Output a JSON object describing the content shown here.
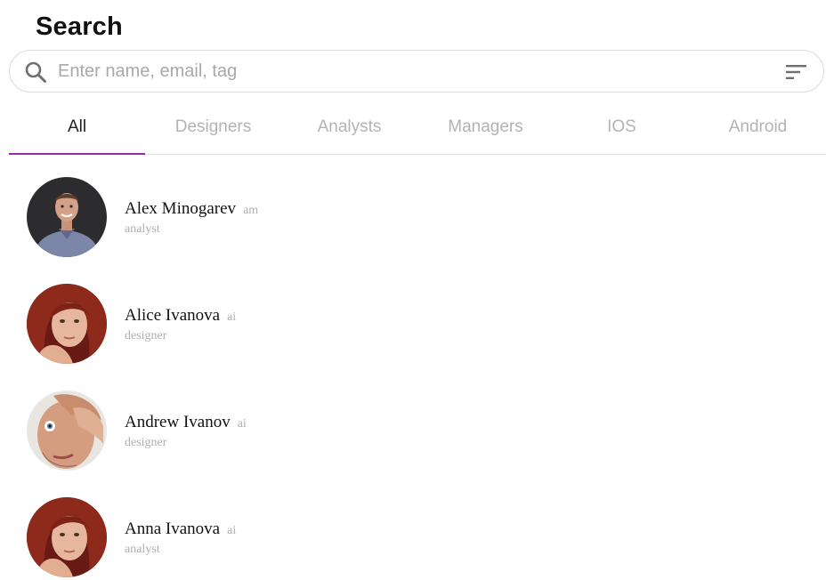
{
  "header": {
    "title": "Search"
  },
  "search": {
    "placeholder": "Enter name, email, tag",
    "value": "",
    "icon": "search-icon",
    "filter_icon": "filter-sort-icon"
  },
  "tabs": [
    {
      "label": "All",
      "active": true
    },
    {
      "label": "Designers",
      "active": false
    },
    {
      "label": "Analysts",
      "active": false
    },
    {
      "label": "Managers",
      "active": false
    },
    {
      "label": "IOS",
      "active": false
    },
    {
      "label": "Android",
      "active": false
    }
  ],
  "people": [
    {
      "name": "Alex Minogarev",
      "initials": "am",
      "role": "analyst"
    },
    {
      "name": "Alice Ivanova",
      "initials": "ai",
      "role": "designer"
    },
    {
      "name": "Andrew Ivanov",
      "initials": "ai",
      "role": "designer"
    },
    {
      "name": "Anna Ivanova",
      "initials": "ai",
      "role": "analyst"
    }
  ],
  "colors": {
    "accent": "#9c27b0",
    "tab_inactive": "#b3b3b3",
    "tab_active": "#222222",
    "secondary_text": "#b0b0b0"
  }
}
